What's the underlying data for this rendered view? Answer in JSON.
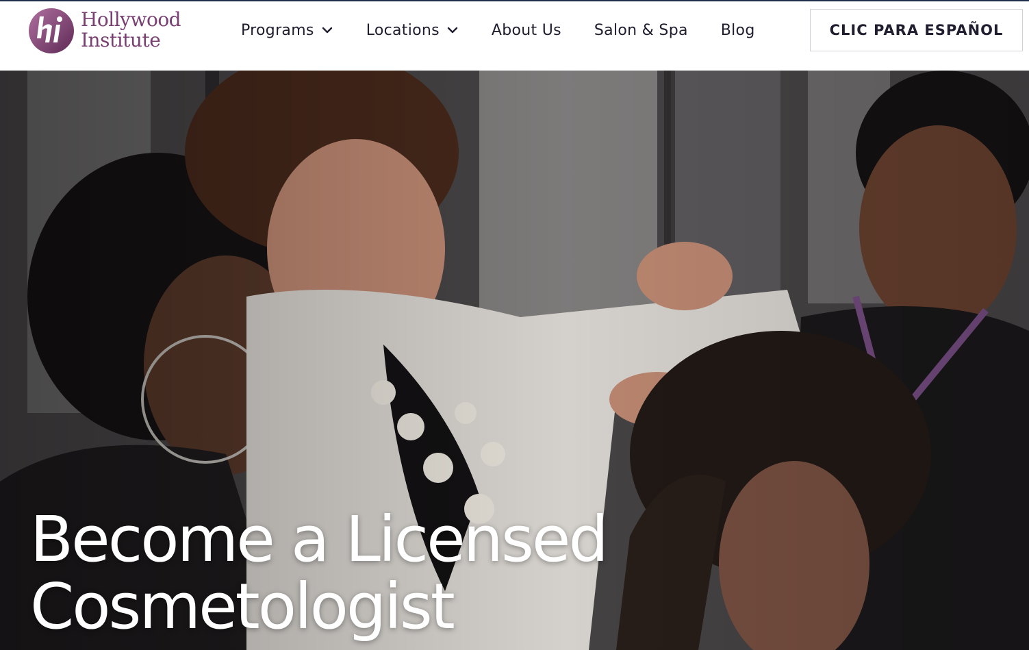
{
  "brand": {
    "logo_line1": "Hollywood",
    "logo_line2": "Institute",
    "logo_icon": "hi-monogram",
    "brand_color": "#7a3f72"
  },
  "nav": {
    "items": [
      {
        "label": "Programs",
        "has_dropdown": true
      },
      {
        "label": "Locations",
        "has_dropdown": true
      },
      {
        "label": "About Us",
        "has_dropdown": false
      },
      {
        "label": "Salon & Spa",
        "has_dropdown": false
      },
      {
        "label": "Blog",
        "has_dropdown": false
      }
    ],
    "dropdown_icon": "chevron-down-icon"
  },
  "cta": {
    "language_button": "CLIC PARA ESPAÑOL"
  },
  "hero": {
    "title_line1": "Become a Licensed",
    "title_line2": "Cosmetologist",
    "image_subject": "cosmetology students and instructor styling a mannequin head"
  }
}
